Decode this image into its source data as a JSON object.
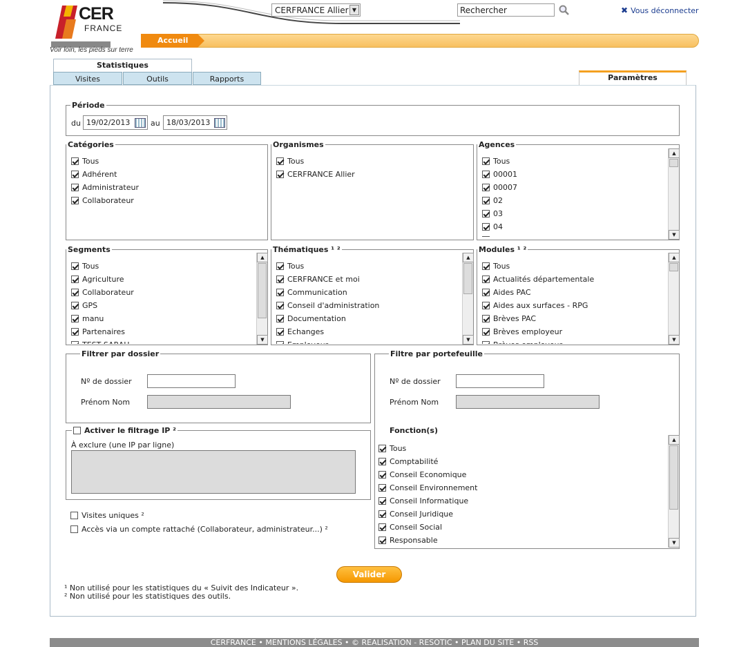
{
  "brand": {
    "name_line1": "CER",
    "name_line2": "FRANCE",
    "tagline": "Voir loin, les pieds sur terre"
  },
  "header": {
    "organism_select": "CERFRANCE Allier",
    "search_placeholder": "Rechercher",
    "logout_label": "Vous déconnecter"
  },
  "breadcrumb": {
    "home": "Accueil"
  },
  "tabs": {
    "statistics": "Statistiques",
    "visites": "Visites",
    "outils": "Outils",
    "rapports": "Rapports",
    "parametres": "Paramètres"
  },
  "periode": {
    "legend": "Période",
    "from_label": "du",
    "from": "19/02/2013",
    "to_label": "au",
    "to": "18/03/2013"
  },
  "categories": {
    "legend": "Catégories",
    "items": [
      "Tous",
      "Adhérent",
      "Administrateur",
      "Collaborateur"
    ]
  },
  "organismes": {
    "legend": "Organismes",
    "items": [
      "Tous",
      "CERFRANCE Allier"
    ]
  },
  "agences": {
    "legend": "Agences",
    "items": [
      "Tous",
      "00001",
      "00007",
      "02",
      "03",
      "04",
      "05"
    ]
  },
  "segments": {
    "legend": "Segments",
    "items": [
      "Tous",
      "Agriculture",
      "Collaborateur",
      "GPS",
      "manu",
      "Partenaires",
      "TEST SARAH"
    ]
  },
  "thematiques": {
    "legend": "Thématiques ¹ ²",
    "items": [
      "Tous",
      "CERFRANCE et moi",
      "Communication",
      "Conseil d'administration",
      "Documentation",
      "Echanges",
      "Employeur"
    ]
  },
  "modules": {
    "legend": "Modules ¹ ²",
    "items": [
      "Tous",
      "Actualités départementale",
      "Aides PAC",
      "Aides aux surfaces - RPG",
      "Brèves PAC",
      "Brèves employeur",
      "Brèves employeur"
    ]
  },
  "filtre_dossier": {
    "legend": "Filtrer par dossier",
    "num_label": "Nº de dossier",
    "name_label": "Prénom Nom"
  },
  "filtre_portefeuille": {
    "legend": "Filtre par portefeuille",
    "num_label": "Nº de dossier",
    "name_label": "Prénom Nom",
    "fonctions_label": "Fonction(s)",
    "fonctions": [
      "Tous",
      "Comptabilité",
      "Conseil Economique",
      "Conseil Environnement",
      "Conseil Informatique",
      "Conseil Juridique",
      "Conseil Social",
      "Responsable"
    ]
  },
  "filtrage_ip": {
    "legend": "Activer le filtrage IP ²",
    "exclude_label": "À exclure (une IP par ligne)"
  },
  "options": {
    "visites_uniques": "Visites uniques ²",
    "acces_rattache": "Accès via un compte rattaché (Collaborateur, administrateur...) ²"
  },
  "submit": "Valider",
  "notes": [
    "¹ Non utilisé pour les statistiques du « Suivit des Indicateur ».",
    "² Non utilisé pour les statistiques des outils."
  ],
  "footer": "CERFRANCE • MENTIONS LÉGALES • © REALISATION - RESOTIC • PLAN DU SITE • RSS",
  "colors": {
    "accent": "#f59800",
    "tab_blue": "#cde3ef",
    "link": "#1b3c8f",
    "logo_red": "#c8202a"
  }
}
